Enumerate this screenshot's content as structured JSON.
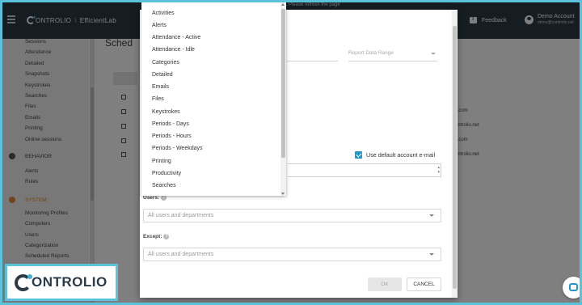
{
  "app": {
    "brand_suffix": "ONTROLIO",
    "workspace": "EfficientLab",
    "refresh_note": "ed. Please refresh the page",
    "feedback": "Feedback",
    "account_name": "Demo Account",
    "account_email": "demo@controlio.net"
  },
  "sidebar": {
    "items_top": [
      "Sessions",
      "Attendance",
      "Detailed",
      "Snapshots",
      "Keystrokes",
      "Searches",
      "Files",
      "Emails",
      "Printing",
      "Online sessions"
    ],
    "behavior_label": "BEHAVIOR",
    "behavior_items": [
      "Alerts",
      "Rules"
    ],
    "system_label": "SYSTEM",
    "system_items": [
      "Monitoring Profiles",
      "Computers",
      "Users",
      "Categorization",
      "Scheduled Reports"
    ]
  },
  "page": {
    "title": "Sched",
    "emails": [
      "il.com",
      "ontrolio.net",
      "il.com",
      "ontrolio.net"
    ]
  },
  "modal": {
    "report_range_placeholder": "Report Data Range",
    "use_default_label": "Use default account e-mail",
    "users_label": "Users:",
    "users_placeholder": "All users and departments",
    "except_label": "Except:",
    "except_placeholder": "All users and departments",
    "ok": "OK",
    "cancel": "CANCEL"
  },
  "dropdown": {
    "options": [
      "Activities",
      "Alerts",
      "Attendance - Active",
      "Attendance - Idle",
      "Categories",
      "Detailed",
      "Emails",
      "Files",
      "Keystrokes",
      "Periods - Days",
      "Periods - Hours",
      "Periods - Weekdays",
      "Printing",
      "Productivity",
      "Searches"
    ]
  },
  "watermark": {
    "text": "ONTROLIO"
  },
  "colors": {
    "header": "#2b3a47",
    "accent": "#2596c9",
    "border": "#5bc2dc",
    "system": "#e08b36"
  }
}
